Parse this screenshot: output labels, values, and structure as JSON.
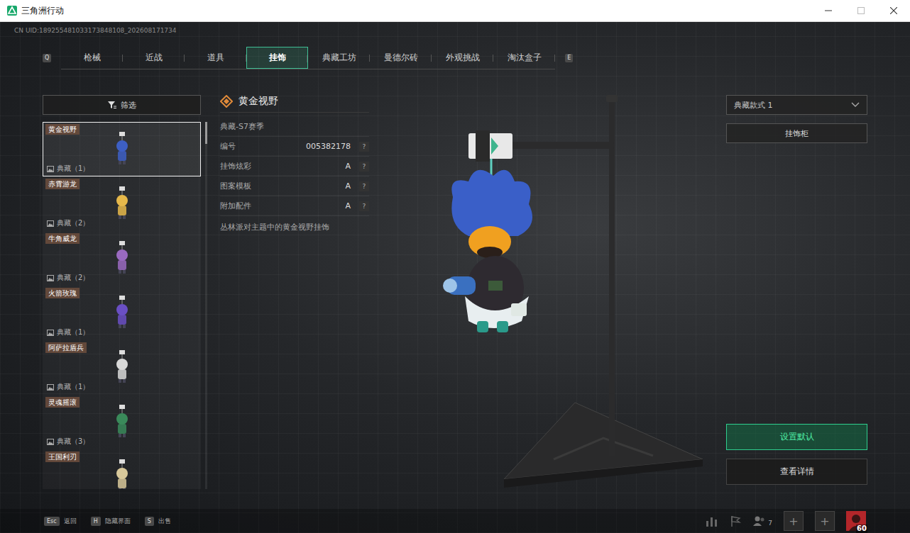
{
  "window": {
    "title": "三角洲行动"
  },
  "uid": "CN UID:189255481033173848108_202608171734",
  "tab_keys": {
    "prev": "Q",
    "next": "E"
  },
  "tabs": [
    {
      "label": "枪械",
      "selected": false
    },
    {
      "label": "近战",
      "selected": false
    },
    {
      "label": "道具",
      "selected": false
    },
    {
      "label": "挂饰",
      "selected": true
    },
    {
      "label": "典藏工坊",
      "selected": false
    },
    {
      "label": "曼德尔砖",
      "selected": false
    },
    {
      "label": "外观挑战",
      "selected": false
    },
    {
      "label": "淘汰盒子",
      "selected": false
    }
  ],
  "filter": {
    "label": "筛选"
  },
  "items": [
    {
      "name": "黄金视野",
      "badge": "典藏（1）",
      "selected": true,
      "color": "#3d5fc4"
    },
    {
      "name": "赤霄游龙",
      "badge": "典藏（2）",
      "selected": false,
      "color": "#e6b84a"
    },
    {
      "name": "牛角威龙",
      "badge": "典藏（2）",
      "selected": false,
      "color": "#9a6ac0"
    },
    {
      "name": "火箭玫瑰",
      "badge": "典藏（1）",
      "selected": false,
      "color": "#6a4fc4"
    },
    {
      "name": "阿萨拉盾兵",
      "badge": "典藏（1）",
      "selected": false,
      "color": "#d8d8d8"
    },
    {
      "name": "灵魂摇滚",
      "badge": "典藏（3）",
      "selected": false,
      "color": "#3a8a5a"
    },
    {
      "name": "王国利刃",
      "selected": false,
      "color": "#d8c89a"
    }
  ],
  "scrollbar": {
    "level": 0.06
  },
  "detail": {
    "title": "黄金视野",
    "season": "典藏-S7赛季",
    "rows": [
      {
        "label": "编号",
        "value": "005382178",
        "help": "?"
      },
      {
        "label": "挂饰炫彩",
        "value": "A",
        "help": "?"
      },
      {
        "label": "图案模板",
        "value": "A",
        "help": "?"
      },
      {
        "label": "附加配件",
        "value": "A",
        "help": "?"
      }
    ],
    "description": "丛林派对主题中的黄金视野挂饰"
  },
  "style_select": {
    "value": "典藏款式 1"
  },
  "cabinet_button": "挂饰柜",
  "actions": [
    {
      "label": "设置默认",
      "primary": true
    },
    {
      "label": "查看详情",
      "primary": false
    }
  ],
  "shortcuts": [
    {
      "key": "Esc",
      "label": "返回"
    },
    {
      "key": "H",
      "label": "隐藏界面"
    },
    {
      "key": "S",
      "label": "出售"
    }
  ],
  "hud": {
    "friends": "7",
    "plus": [
      "+",
      "+"
    ],
    "level": "60"
  }
}
